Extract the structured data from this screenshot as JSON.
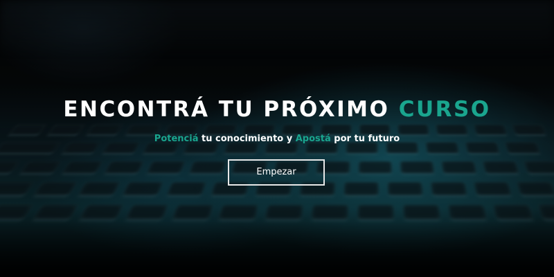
{
  "hero": {
    "title_main": "ENCONTRÁ TU PRÓXIMO ",
    "title_accent": "CURSO",
    "subtitle_parts": {
      "accent1": "Potenciá",
      "text1": " tu conocimiento y ",
      "accent2": "Apostá",
      "text2": " por tu futuro"
    },
    "cta_label": "Empezar"
  },
  "colors": {
    "accent": "#1aa58e",
    "text": "#ffffff",
    "background": "#000000"
  }
}
